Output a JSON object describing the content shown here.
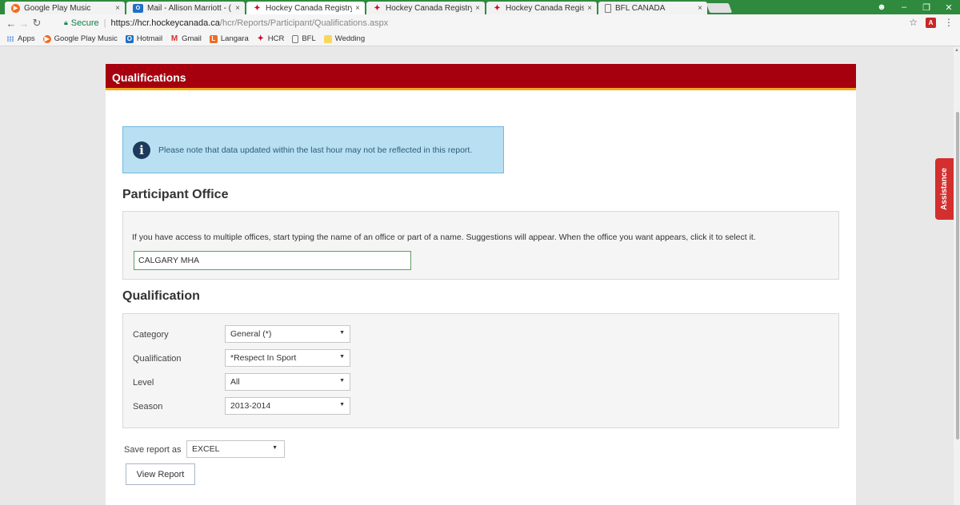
{
  "browser": {
    "tabs": [
      {
        "title": "Google Play Music",
        "favicon": "google-play-music-icon"
      },
      {
        "title": "Mail - Allison Marriott - (",
        "favicon": "outlook-icon"
      },
      {
        "title": "Hockey Canada Registry",
        "favicon": "hockey-canada-icon"
      },
      {
        "title": "Hockey Canada Registry",
        "favicon": "hockey-canada-icon"
      },
      {
        "title": "Hockey Canada Registry",
        "favicon": "hockey-canada-icon"
      },
      {
        "title": "BFL CANADA",
        "favicon": "document-icon"
      }
    ],
    "tab_close": "×",
    "active_tab_index": 2,
    "address": {
      "secure_label": "Secure",
      "url_host": "https://hcr.hockeycanada.ca",
      "url_path": "/hcr/Reports/Participant/Qualifications.aspx"
    },
    "bookmarks": [
      {
        "label": "Apps",
        "icon": "apps-grid-icon"
      },
      {
        "label": "Google Play Music",
        "icon": "google-play-music-icon"
      },
      {
        "label": "Hotmail",
        "icon": "outlook-icon"
      },
      {
        "label": "Gmail",
        "icon": "gmail-icon"
      },
      {
        "label": "Langara",
        "icon": "langara-icon"
      },
      {
        "label": "HCR",
        "icon": "hockey-canada-icon"
      },
      {
        "label": "BFL",
        "icon": "document-icon"
      },
      {
        "label": "Wedding",
        "icon": "folder-icon"
      }
    ],
    "accent_color": "#2f8a3e"
  },
  "page": {
    "header_title": "Qualifications",
    "header_color": "#a6000f",
    "header_border_color": "#f2a81d",
    "info_message": "Please note that data updated within the last hour may not be reflected in this report.",
    "participant_office": {
      "title": "Participant Office",
      "help_text": "If you have access to multiple offices, start typing the name of an office or part of a name. Suggestions will appear. When the office you want appears, click it to select it.",
      "office_value": "CALGARY MHA"
    },
    "qualification": {
      "title": "Qualification",
      "fields": [
        {
          "label": "Category",
          "value": "General (*)"
        },
        {
          "label": "Qualification",
          "value": "*Respect In Sport"
        },
        {
          "label": "Level",
          "value": "All"
        },
        {
          "label": "Season",
          "value": "2013-2014"
        }
      ]
    },
    "save_report_label": "Save report as",
    "save_report_value": "EXCEL",
    "view_report_label": "View Report",
    "assistance_label": "Assistance"
  }
}
